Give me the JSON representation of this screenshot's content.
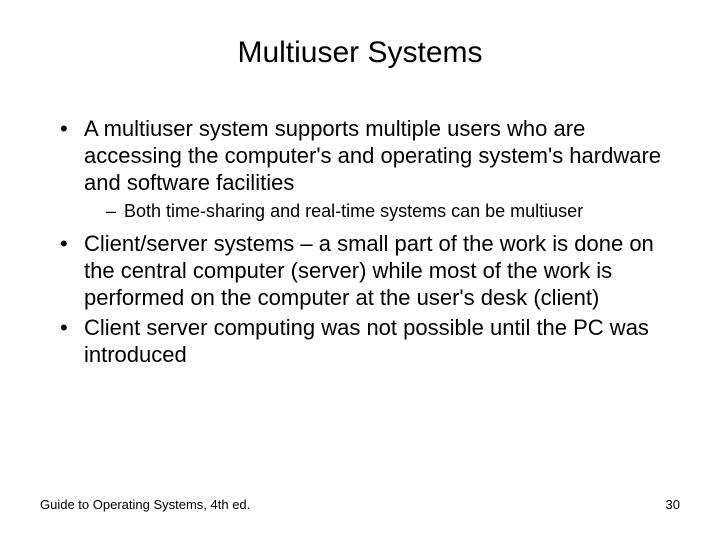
{
  "title": "Multiuser Systems",
  "bullets": {
    "b1": "A multiuser system supports multiple users who are accessing the computer's and operating system's hardware and software facilities",
    "b1_sub": "Both time-sharing and real-time systems can be multiuser",
    "b2": "Client/server systems – a small part of the work is done on the central computer (server) while most of the work is performed on the computer at the user's desk (client)",
    "b3": "Client server computing was not possible until the PC was introduced"
  },
  "footer": {
    "left": "Guide to Operating Systems, 4th ed.",
    "right": "30"
  }
}
